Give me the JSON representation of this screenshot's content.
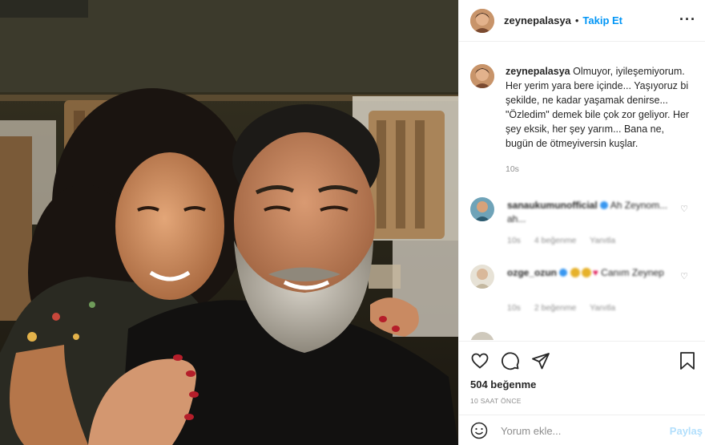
{
  "header": {
    "username": "zeynepalasya",
    "separator": "•",
    "follow_label": "Takip Et",
    "more_icon": "ellipsis-icon"
  },
  "caption": {
    "username": "zeynepalasya",
    "text": "Olmuyor, iyileşemiyorum. Her yerim yara bere içinde... Yaşıyoruz bi şekilde, ne kadar yaşamak denirse... \"Özledim\" demek bile çok zor geliyor. Her şey eksik, her şey yarım... Bana ne, bugün de ötmeyiversin kuşlar.",
    "time": "10s"
  },
  "comments": [
    {
      "username": "sanaukumunofficial",
      "text": "Ah Zeynom... ah...",
      "meta": [
        "10s",
        "4 beğenme",
        "Yanıtla"
      ],
      "verified": true
    },
    {
      "username": "ozge_ozun",
      "text": "Canım Zeynep",
      "meta": [
        "10s",
        "2 beğenme",
        "Yanıtla"
      ],
      "verified": true
    }
  ],
  "actions": {
    "like_icon": "heart-icon",
    "comment_icon": "comment-icon",
    "share_icon": "paper-plane-icon",
    "save_icon": "bookmark-icon",
    "likes": "504 beğenme",
    "timestamp": "10 SAAT ÖNCE"
  },
  "add_comment": {
    "emoji_icon": "smiley-icon",
    "placeholder": "Yorum ekle...",
    "post_label": "Paylaş"
  },
  "colors": {
    "accent": "#0095f6",
    "post_disabled": "#b2dffc",
    "muted": "#8e8e8e",
    "text": "#262626"
  }
}
